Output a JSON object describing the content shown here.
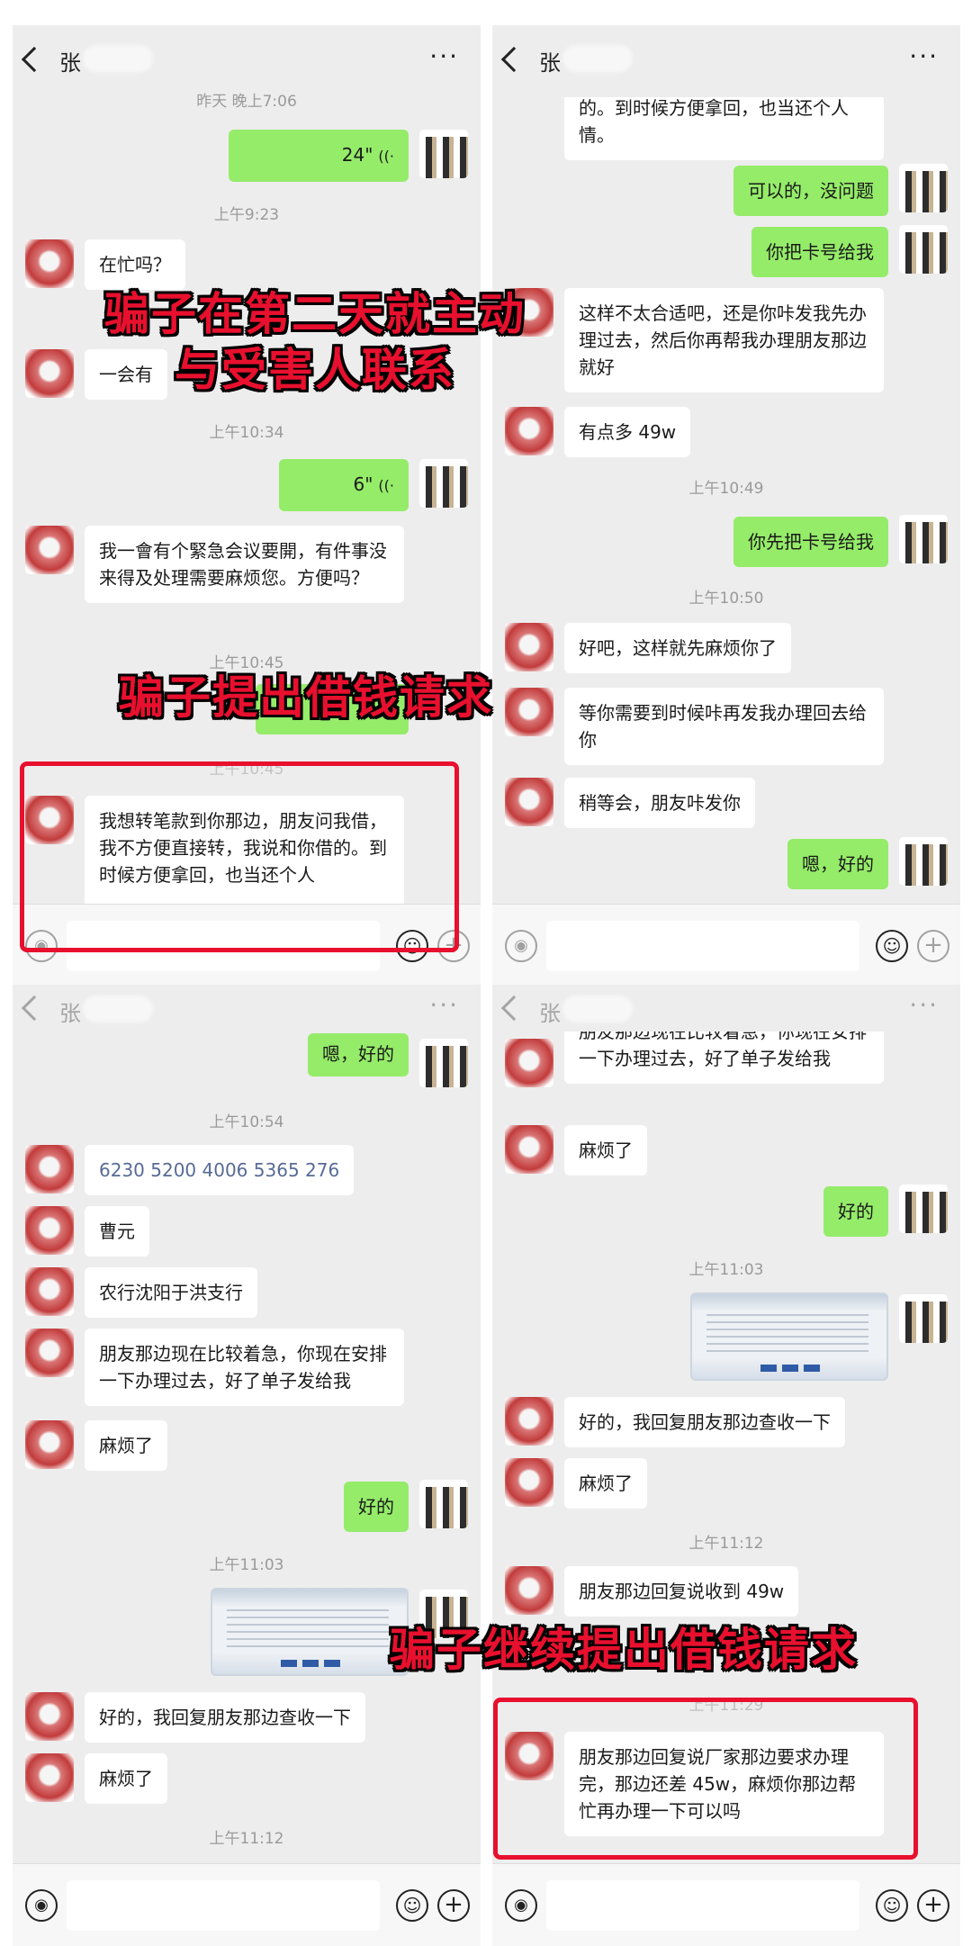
{
  "contact_name": "张",
  "more_icon": "more-icon",
  "caption_colors": {
    "text": "#e8102e",
    "outline": "#000000"
  },
  "panel1": {
    "ts1": "昨天 晚上7:06",
    "voice1": "24\"",
    "ts2": "上午9:23",
    "msg1": "在忙吗？",
    "msg2": "一会有",
    "ts3": "上午10:34",
    "voice2": "6\"",
    "msg3": "我一會有个緊急会议要開，有件事没来得及处理需要麻烦您。方便吗？",
    "ts4": "上午10:45",
    "ts5": "上午10:45",
    "msg4": "我想转笔款到你那边，朋友问我借，我不方便直接转，我说和你借的。到时候方便拿回，也当还个人"
  },
  "panel2": {
    "msg1": "的。到时候方便拿回，也当还个人情。",
    "msg2": "可以的，没问题",
    "msg3": "你把卡号给我",
    "msg4": "这样不太合适吧，还是你咔发我先办理过去，然后你再帮我办理朋友那边就好",
    "msg5": "有点多 49w",
    "ts1": "上午10:49",
    "msg6": "你先把卡号给我",
    "ts2": "上午10:50",
    "msg7": "好吧，这样就先麻烦你了",
    "msg8": "等你需要到时候咔再发我办理回去给你",
    "msg9": "稍等会，朋友咔发你",
    "msg10": "嗯，好的"
  },
  "panel3": {
    "msg0": "嗯，好的",
    "ts1": "上午10:54",
    "msg1": "6230 5200 4006 5365 276",
    "msg2": "曹元",
    "msg3": "农行沈阳于洪支行",
    "msg4": "朋友那边现在比较着急，你现在安排一下办理过去，好了单子发给我",
    "msg5": "麻烦了",
    "msg6": "好的",
    "ts2": "上午11:03",
    "msg7": "好的，我回复朋友那边查收一下",
    "msg8": "麻烦了",
    "ts3": "上午11:12"
  },
  "panel4": {
    "msg0": "朋友那边现在比较着急，你现在安排一下办理过去，好了单子发给我",
    "msg1": "麻烦了",
    "msg2": "好的",
    "ts1": "上午11:03",
    "msg3": "好的，我回复朋友那边查收一下",
    "msg4": "麻烦了",
    "ts2": "上午11:12",
    "msg5": "朋友那边回复说收到 49w",
    "ts3": "上午11:29",
    "msg6": "朋友那边回复说厂家那边要求办理完，那边还差 45w，麻烦你那边帮忙再办理一下可以吗"
  },
  "captions": {
    "c1a": "骗子在第二天就主动",
    "c1b": "与受害人联系",
    "c2": "骗子提出借钱请求",
    "c3": "骗子继续提出借钱请求"
  }
}
